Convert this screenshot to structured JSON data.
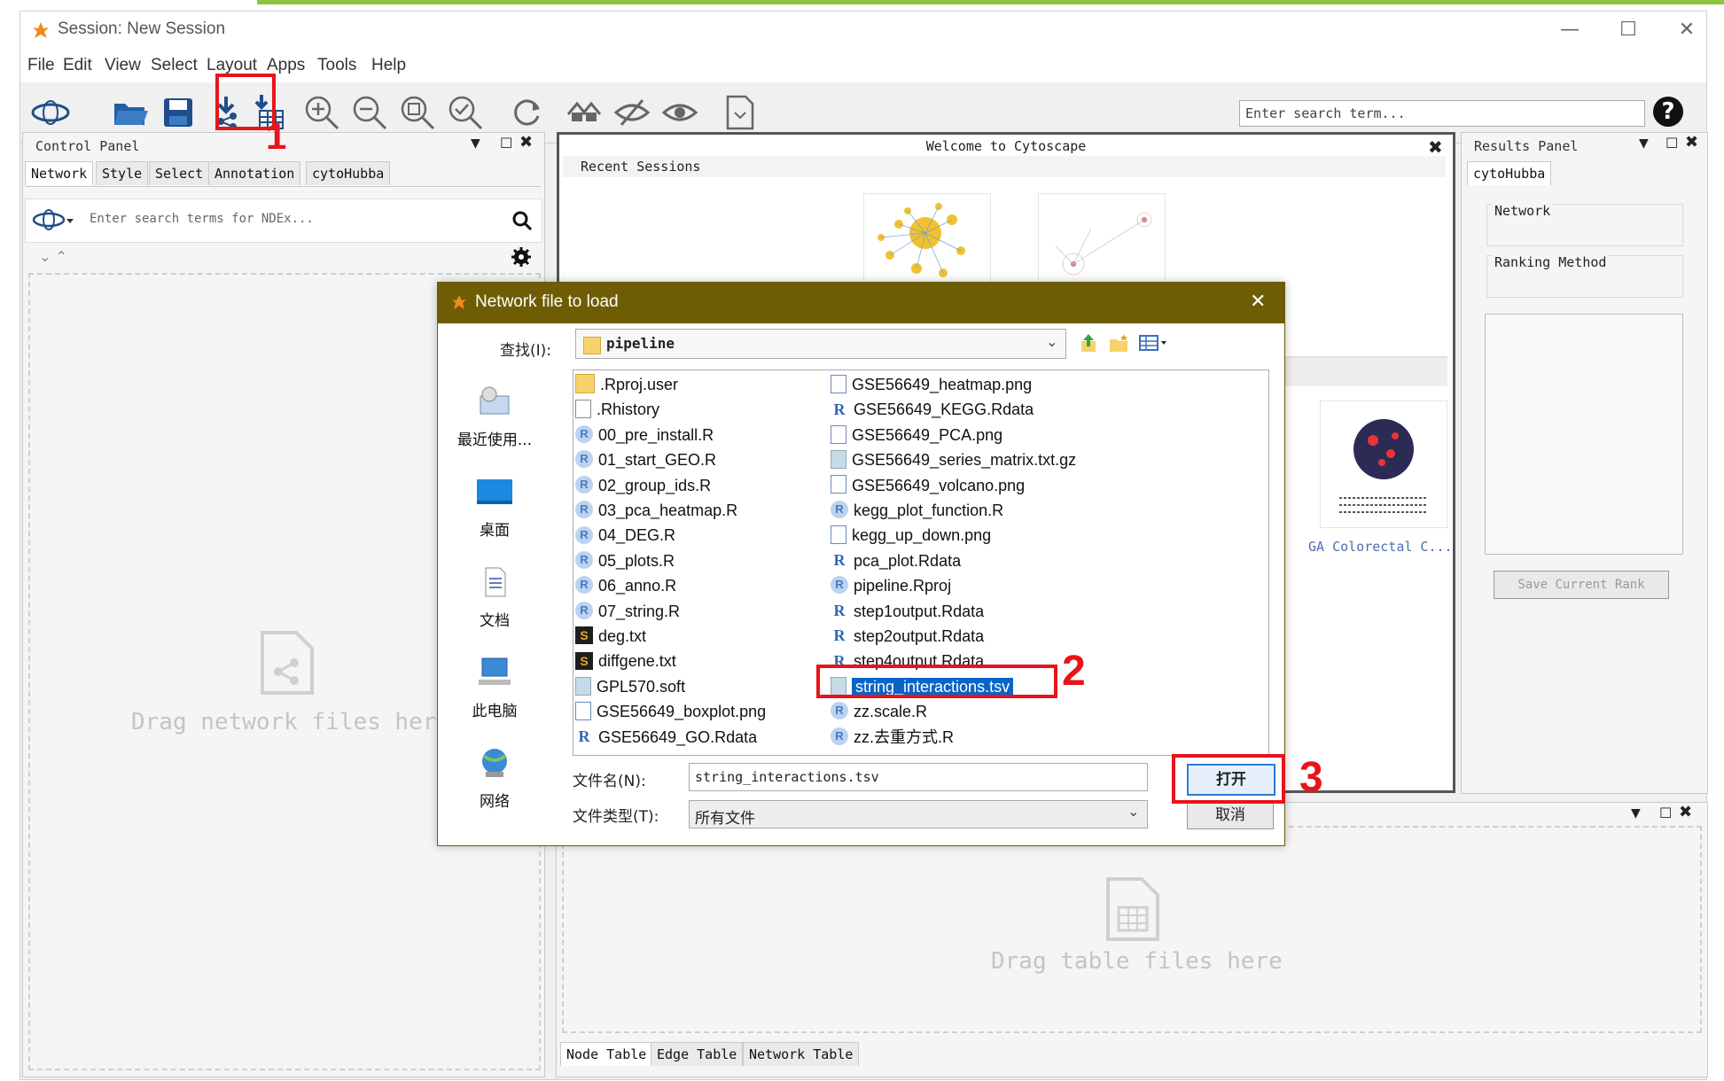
{
  "window": {
    "title": "Session: New Session",
    "controls": {
      "minimize": "—",
      "maximize": "☐",
      "close": "✕"
    }
  },
  "menu": [
    "File",
    "Edit",
    "View",
    "Select",
    "Layout",
    "Apps",
    "Tools",
    "Help"
  ],
  "toolbar": {
    "search_placeholder": "Enter search term...",
    "help_icon": "?",
    "icons": [
      "network-logo-icon",
      "open-folder-icon",
      "save-icon",
      "import-network-icon",
      "import-table-icon",
      "zoom-in-icon",
      "zoom-out-icon",
      "zoom-fit-icon",
      "zoom-selected-icon",
      "refresh-icon",
      "home-icon",
      "hide-icon",
      "show-icon",
      "export-doc-icon"
    ]
  },
  "control_panel": {
    "title": "Control Panel",
    "tabs": [
      "Network",
      "Style",
      "Select",
      "Annotation",
      "cytoHubba"
    ],
    "search_placeholder": "Enter search terms for NDEx...",
    "drag_text": "Drag network files here"
  },
  "welcome": {
    "title": "Welcome to Cytoscape",
    "recent_sessions_label": "Recent Sessions",
    "sample_label": "GA Colorectal C..."
  },
  "results_panel": {
    "title": "Results Panel",
    "tab": "cytoHubba",
    "network_label": "Network",
    "ranking_label": "Ranking Method",
    "save_button": "Save Current Rank"
  },
  "table_panel": {
    "drag_text": "Drag table files here",
    "tabs": [
      "Node Table",
      "Edge Table",
      "Network Table"
    ]
  },
  "dialog": {
    "title": "Network file to load",
    "look_in_label": "查找(I):",
    "folder": "pipeline",
    "places": [
      "最近使用...",
      "桌面",
      "文档",
      "此电脑",
      "网络"
    ],
    "files_col1": [
      {
        "name": ".Rproj.user",
        "type": "folder"
      },
      {
        "name": ".Rhistory",
        "type": "doc"
      },
      {
        "name": "00_pre_install.R",
        "type": "r"
      },
      {
        "name": "01_start_GEO.R",
        "type": "r"
      },
      {
        "name": "02_group_ids.R",
        "type": "r"
      },
      {
        "name": "03_pca_heatmap.R",
        "type": "r"
      },
      {
        "name": "04_DEG.R",
        "type": "r"
      },
      {
        "name": "05_plots.R",
        "type": "r"
      },
      {
        "name": "06_anno.R",
        "type": "r"
      },
      {
        "name": "07_string.R",
        "type": "r"
      },
      {
        "name": "deg.txt",
        "type": "txt"
      },
      {
        "name": "diffgene.txt",
        "type": "txt"
      },
      {
        "name": "GPL570.soft",
        "type": "gz"
      },
      {
        "name": "GSE56649_boxplot.png",
        "type": "img"
      },
      {
        "name": "GSE56649_GO.Rdata",
        "type": "rdata"
      }
    ],
    "files_col2": [
      {
        "name": "GSE56649_heatmap.png",
        "type": "img"
      },
      {
        "name": "GSE56649_KEGG.Rdata",
        "type": "rdata"
      },
      {
        "name": "GSE56649_PCA.png",
        "type": "img"
      },
      {
        "name": "GSE56649_series_matrix.txt.gz",
        "type": "gz"
      },
      {
        "name": "GSE56649_volcano.png",
        "type": "img"
      },
      {
        "name": "kegg_plot_function.R",
        "type": "r"
      },
      {
        "name": "kegg_up_down.png",
        "type": "img"
      },
      {
        "name": "pca_plot.Rdata",
        "type": "rdata"
      },
      {
        "name": "pipeline.Rproj",
        "type": "rproj"
      },
      {
        "name": "step1output.Rdata",
        "type": "rdata"
      },
      {
        "name": "step2output.Rdata",
        "type": "rdata"
      },
      {
        "name": "step4output.Rdata",
        "type": "rdata"
      },
      {
        "name": "string_interactions.tsv",
        "type": "gz",
        "selected": true
      },
      {
        "name": "zz.scale.R",
        "type": "r"
      },
      {
        "name": "zz.去重方式.R",
        "type": "r"
      }
    ],
    "filename_label": "文件名(N):",
    "filename_value": "string_interactions.tsv",
    "filetype_label": "文件类型(T):",
    "filetype_value": "所有文件",
    "open_button": "打开",
    "cancel_button": "取消"
  },
  "annotations": {
    "step1": "1",
    "step2": "2",
    "step3": "3"
  },
  "colors": {
    "annotation_red": "#e8141b",
    "dialog_title_bg": "#6e5d05",
    "selected_blue": "#0a64c8",
    "top_accent": "#8cc63f"
  }
}
